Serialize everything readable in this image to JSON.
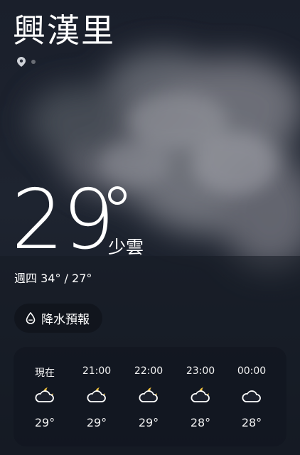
{
  "location": {
    "city": "興漢里"
  },
  "current": {
    "temperature": "29",
    "condition": "少雲",
    "day_range": "週四 34° / 27°"
  },
  "precipitation_button": {
    "label": "降水預報"
  },
  "hourly": [
    {
      "time": "現在",
      "temp": "29°",
      "icon": "partly-cloudy-night-icon"
    },
    {
      "time": "21:00",
      "temp": "29°",
      "icon": "partly-cloudy-night-icon"
    },
    {
      "time": "22:00",
      "temp": "29°",
      "icon": "partly-cloudy-night-icon"
    },
    {
      "time": "23:00",
      "temp": "28°",
      "icon": "partly-cloudy-night-icon"
    },
    {
      "time": "00:00",
      "temp": "28°",
      "icon": "cloud-icon"
    }
  ],
  "colors": {
    "background": "#1c2230",
    "moon": "#f5c542",
    "card": "#121620"
  }
}
